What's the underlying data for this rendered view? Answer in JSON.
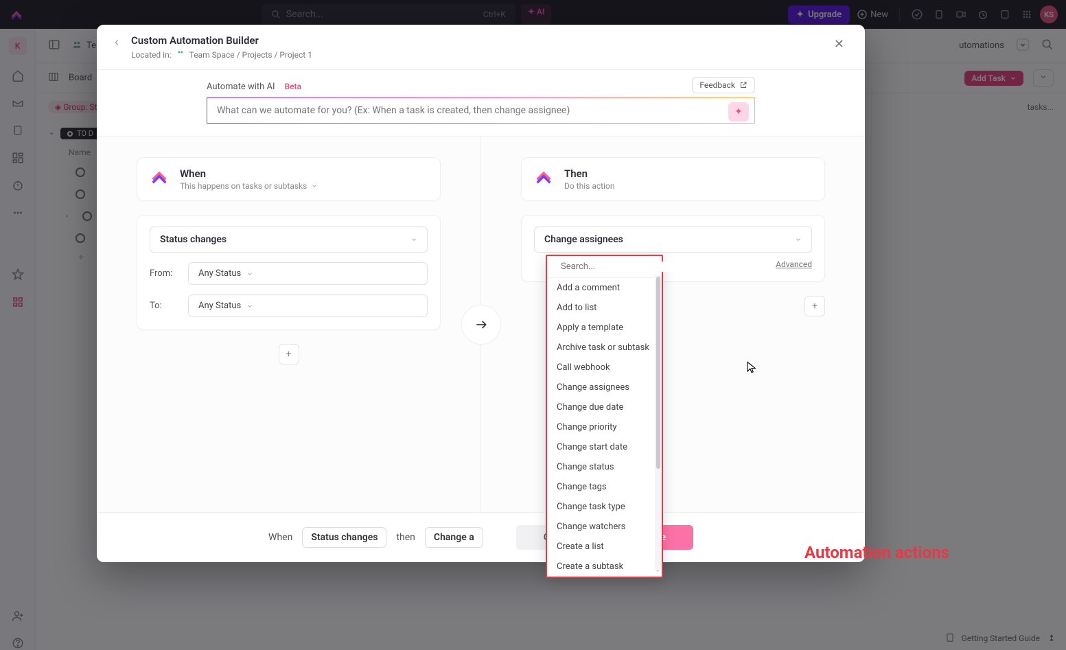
{
  "topbar": {
    "search_placeholder": "Search...",
    "search_kbd": "Ctrl+K",
    "ai_label": "✦ AI",
    "upgrade": "Upgrade",
    "new": "New",
    "avatar": "KS"
  },
  "leftrail": {
    "workspace_initial": "K"
  },
  "background": {
    "team_label": "Team",
    "board_label": "Board",
    "automations_label": "utomations",
    "add_task": "Add Task",
    "group_chip": "Group: Stat",
    "search_tasks": "tasks...",
    "todo": "TO D",
    "name_header": "Name",
    "footer_guide": "Getting Started Guide"
  },
  "modal": {
    "title": "Custom Automation Builder",
    "located_in": "Located in:",
    "breadcrumb": "Team Space / Projects / Project 1",
    "ai_label": "Automate with AI",
    "beta": "Beta",
    "feedback": "Feedback",
    "ai_placeholder": "What can we automate for you? (Ex: When a task is created, then change assignee)",
    "when": {
      "title": "When",
      "subtitle": "This happens on tasks or subtasks",
      "select_label": "Status changes",
      "from": "From:",
      "to": "To:",
      "any": "Any Status"
    },
    "then": {
      "title": "Then",
      "subtitle": "Do this action",
      "select_label": "Change assignees",
      "advanced": "Advanced"
    },
    "footer": {
      "when": "When",
      "status": "Status changes",
      "then": "then",
      "change": "Change a",
      "cancel": "Cancel",
      "create": "Create"
    }
  },
  "actions_popover": {
    "search_placeholder": "Search...",
    "items": [
      "Add a comment",
      "Add to list",
      "Apply a template",
      "Archive task or subtask",
      "Call webhook",
      "Change assignees",
      "Change due date",
      "Change priority",
      "Change start date",
      "Change status",
      "Change tags",
      "Change task type",
      "Change watchers",
      "Create a list",
      "Create a subtask"
    ]
  },
  "annotation": "Automation actions"
}
